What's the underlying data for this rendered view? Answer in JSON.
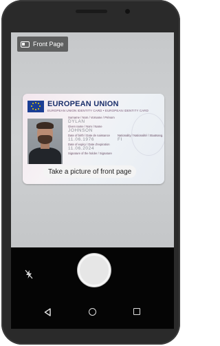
{
  "camera": {
    "mode_chip_label": "Front Page",
    "prompt_text": "Take a picture of front page"
  },
  "id_card": {
    "title": "EUROPEAN UNION",
    "subtitle": "EUROPEAN UNION IDENTITY CARD • EUROPEAN IDENTITY CARD",
    "fields": {
      "surname_label": "Surname / Nom / Vorname / Prénom",
      "surname_value": "DYLAN",
      "given_label": "Given name / Nom / Name",
      "given_value": "JOHNSON",
      "dob_label": "Date of birth / Date de naissance",
      "dob_value": "11.06.1976",
      "nationality_label": "Nationality / Nationalité / Staatsang.",
      "nationality_value": "FI",
      "expiry_label": "Date of expiry / Date d'expiration",
      "expiry_value": "11.06.2024",
      "signature_label": "Signature of the holder / Signature"
    }
  },
  "icons": {
    "mode_chip": "card-icon",
    "flash": "flash-off-icon",
    "shutter": "shutter-button",
    "nav_back": "back-triangle-icon",
    "nav_home": "home-circle-icon",
    "nav_recent": "recent-apps-square-icon"
  }
}
